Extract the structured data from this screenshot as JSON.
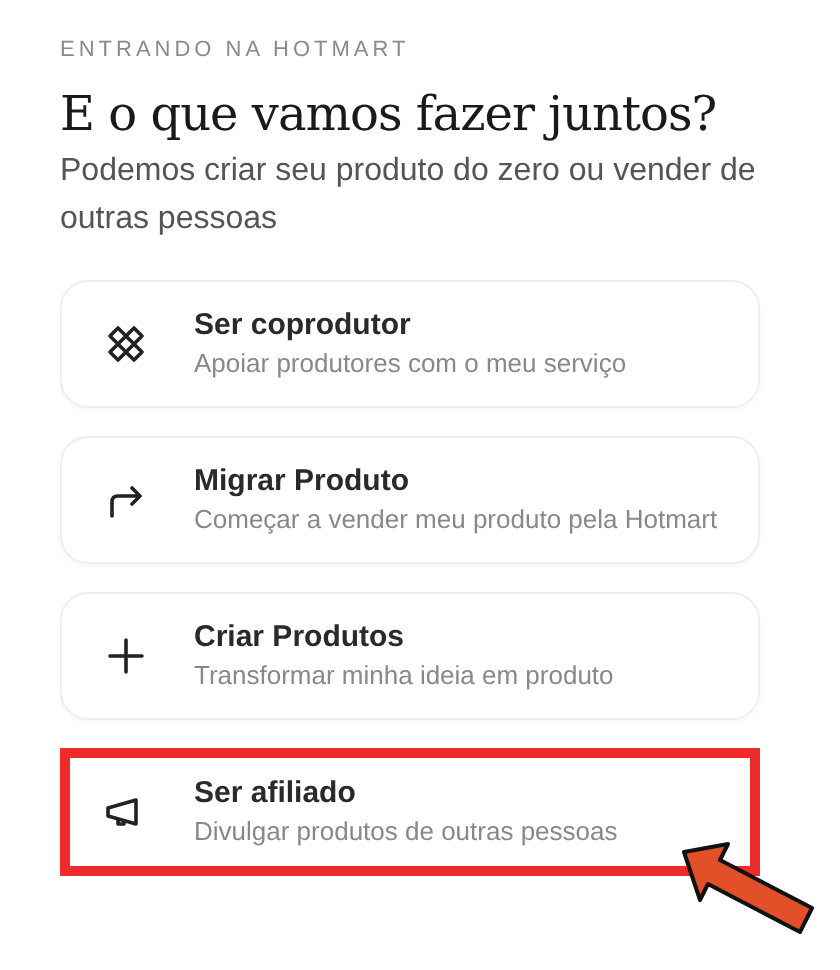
{
  "eyebrow": "ENTRANDO NA HOTMART",
  "title": "E o que vamos fazer juntos?",
  "subtitle": "Podemos criar seu produto do zero ou vender de outras pessoas",
  "options": [
    {
      "kind": "tools",
      "title": "Ser coprodutor",
      "description": "Apoiar produtores com o meu serviço",
      "highlighted": false
    },
    {
      "kind": "redirect",
      "title": "Migrar Produto",
      "description": "Começar a vender meu produto pela Hotmart",
      "highlighted": false
    },
    {
      "kind": "plus",
      "title": "Criar Produtos",
      "description": "Transformar minha ideia em produto",
      "highlighted": false
    },
    {
      "kind": "megaphone",
      "title": "Ser afiliado",
      "description": "Divulgar produtos de outras pessoas",
      "highlighted": true
    }
  ]
}
